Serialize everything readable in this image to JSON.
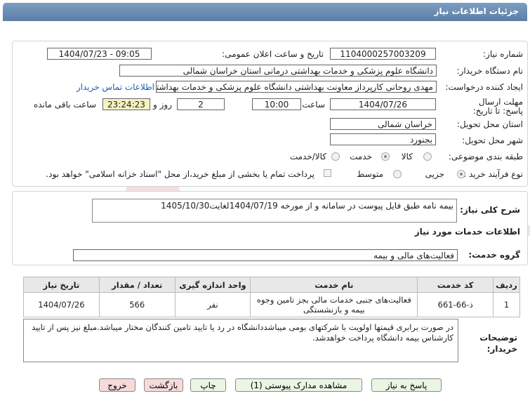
{
  "title": "جزئیات اطلاعات نیاز",
  "fields": {
    "need_number_label": "شماره نیاز:",
    "need_number": "1104000257003209",
    "announce_label": "تاریخ و ساعت اعلان عمومی:",
    "announce_value": "1404/07/23 - 09:05",
    "buyer_org_label": "نام دستگاه خریدار:",
    "buyer_org": "دانشگاه علوم پزشکی و خدمات بهداشتی درمانی استان خراسان شمالی",
    "creator_label": "ایجاد کننده درخواست:",
    "creator": "مهدی روحانی کارپرداز معاونت بهداشتی دانشگاه علوم پزشکی و خدمات بهداشتی",
    "contact_link": "اطلاعات تماس خریدار",
    "deadline_label": "مهلت ارسال پاسخ: تا تاریخ:",
    "deadline_date": "1404/07/26",
    "time_label": "ساعت",
    "deadline_time": "10:00",
    "days_value": "2",
    "days_label": "روز و",
    "remaining_time": "23:24:23",
    "remaining_label": "ساعت باقی مانده",
    "province_label": "استان محل تحویل:",
    "province": "خراسان شمالی",
    "city_label": "شهر محل تحویل:",
    "city": "بجنورد",
    "category_label": "طبقه بندی موضوعی:",
    "category_options": [
      "کالا",
      "خدمت",
      "کالا/خدمت"
    ],
    "process_label": "نوع فرآیند خرید :",
    "process_options": [
      "جزیی",
      "متوسط"
    ],
    "payment_note": "پرداخت تمام یا بخشی از مبلغ خرید،از محل \"اسناد خزانه اسلامی\" خواهد بود."
  },
  "description": {
    "label": "شرح کلی نیاز:",
    "text": "بیمه نامه طبق فایل پیوست در سامانه و از مورخه 1404/07/19لغایت1405/10/30"
  },
  "services": {
    "section_title": "اطلاعات خدمات مورد نیاز",
    "group_label": "گروه خدمت:",
    "group_value": "فعالیت‌های مالی و بیمه",
    "columns": [
      "ردیف",
      "کد خدمت",
      "نام خدمت",
      "واحد اندازه گیری",
      "تعداد / مقدار",
      "تاریخ نیاز"
    ],
    "rows": [
      [
        "1",
        "ذ-66-661",
        "فعالیت‌های جنبی خدمات مالی بجز تامین وجوه بیمه و بازنشستگی",
        "نفر",
        "566",
        "1404/07/26"
      ]
    ]
  },
  "buyer_notes": {
    "label": "توضیحات خریدار:",
    "text": "در صورت برابری قیمتها اولویت با شرکتهای بومی میباشددانشگاه در رد یا تایید تامین کنندگان مختار میباشد.مبلغ نیز پس از تایید کارشناس بیمه دانشگاه پرداخت خواهدشد."
  },
  "buttons": {
    "reply": "پاسخ به نیاز",
    "view_docs": "مشاهده مدارک پیوستی (1)",
    "print": "چاپ",
    "back": "بازگشت",
    "exit": "خروج"
  },
  "watermark": "AriaTender.net",
  "colors": {
    "title_bar": "#6a8cb4",
    "remaining_bg": "#f6f3c2",
    "button_green": "#eaf5e4",
    "button_red": "#f6dada"
  }
}
